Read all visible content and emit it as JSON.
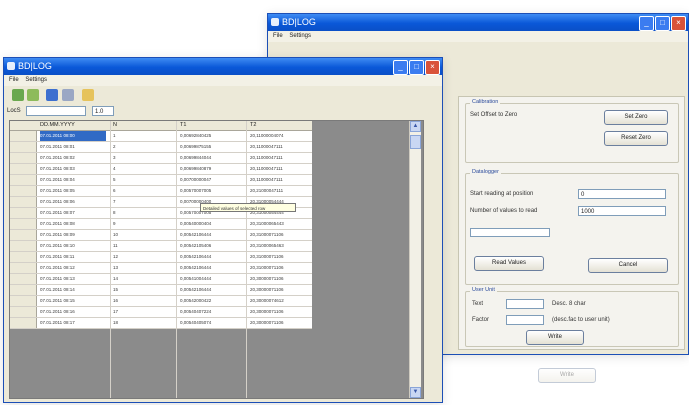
{
  "back_window": {
    "title": "BD|LOG",
    "menu": [
      "File",
      "Settings"
    ],
    "calibration": {
      "title": "Calibration",
      "set_offset_label": "Set Offset to Zero",
      "set_zero_label": "Set Zero",
      "reset_zero_label": "Reset Zero"
    },
    "data_logger": {
      "title": "Datalogger",
      "start_reading_label": "Start reading at position",
      "start_reading_value": "0",
      "number_of_values_label": "Number of values to read",
      "number_of_values_value": "1000",
      "read_values_label": "Read Values",
      "cancel_label": "Cancel"
    },
    "user_unit": {
      "title": "User Unit",
      "text_label": "Text",
      "text_hint": "Desc. 8 char",
      "factor_label": "Factor",
      "factor_hint": "(desc.fac to user unit)",
      "write_label": "Write"
    },
    "ghost_button_label": "Write"
  },
  "front_window": {
    "title": "BD|LOG",
    "menu": [
      "File",
      "Settings"
    ],
    "address": {
      "label": "LocS",
      "value": "1.0"
    },
    "columns": [
      "DD.MM.YYYY",
      "N",
      "T1",
      "T2"
    ],
    "tooltip": "Detailed values of selected row",
    "rows": [
      {
        "date": "07.01.2011 08:00",
        "n": "1",
        "t1": "0,00692840425",
        "t2": "20,11000004074"
      },
      {
        "date": "07.01.2011 08:01",
        "n": "2",
        "t1": "0,00699875155",
        "t2": "20,11000047111"
      },
      {
        "date": "07.01.2011 08:02",
        "n": "3",
        "t1": "0,00699844044",
        "t2": "20,11000047111"
      },
      {
        "date": "07.01.2011 08:03",
        "n": "4",
        "t1": "0,00699840879",
        "t2": "20,11000047111"
      },
      {
        "date": "07.01.2011 08:04",
        "n": "5",
        "t1": "0,00700000047",
        "t2": "20,11000047111"
      },
      {
        "date": "07.01.2011 08:05",
        "n": "6",
        "t1": "0,00570007005",
        "t2": "20,21000047111"
      },
      {
        "date": "07.01.2011 08:06",
        "n": "7",
        "t1": "0,00700000400",
        "t2": "20,31000054444"
      },
      {
        "date": "07.01.2011 08:07",
        "n": "8",
        "t1": "0,00570007005",
        "t2": "20,31000054444"
      },
      {
        "date": "07.01.2011 08:08",
        "n": "9",
        "t1": "0,00540000404",
        "t2": "20,31000065443"
      },
      {
        "date": "07.01.2011 08:09",
        "n": "10",
        "t1": "0,00542106444",
        "t2": "20,31000071106"
      },
      {
        "date": "07.01.2011 08:10",
        "n": "11",
        "t1": "0,00542105406",
        "t2": "20,31000065463"
      },
      {
        "date": "07.01.2011 08:11",
        "n": "12",
        "t1": "0,00542106444",
        "t2": "20,31000071106"
      },
      {
        "date": "07.01.2011 08:12",
        "n": "13",
        "t1": "0,00542106444",
        "t2": "20,31000071106"
      },
      {
        "date": "07.01.2011 08:13",
        "n": "14",
        "t1": "0,00541004444",
        "t2": "20,30000071106"
      },
      {
        "date": "07.01.2011 08:14",
        "n": "15",
        "t1": "0,00542106444",
        "t2": "20,30000071106"
      },
      {
        "date": "07.01.2011 08:15",
        "n": "16",
        "t1": "0,00542000422",
        "t2": "20,30000074612"
      },
      {
        "date": "07.01.2011 08:16",
        "n": "17",
        "t1": "0,00540407224",
        "t2": "20,30000071106"
      },
      {
        "date": "07.01.2011 08:17",
        "n": "18",
        "t1": "0,00540405074",
        "t2": "20,30000071106"
      }
    ]
  }
}
